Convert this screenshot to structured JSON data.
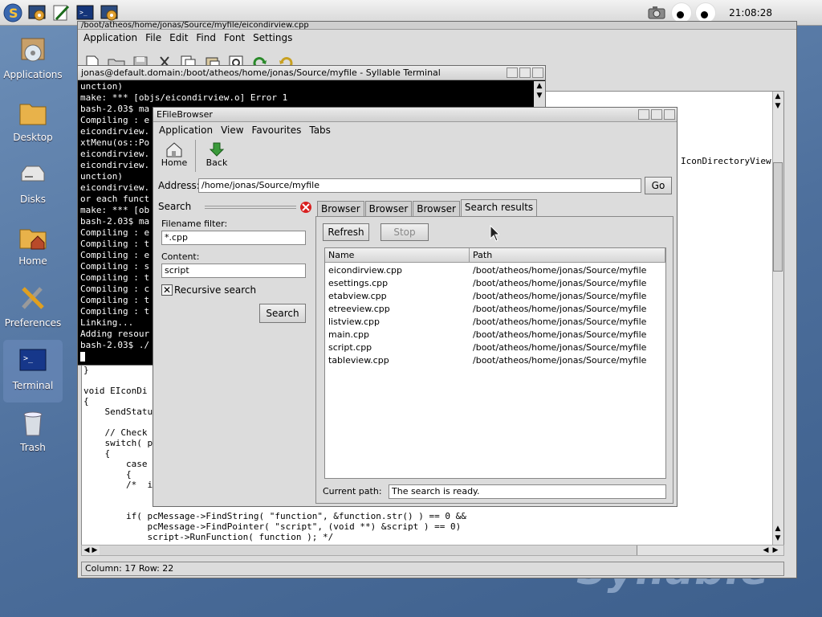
{
  "topbar": {
    "clock": "21:08:28"
  },
  "desktop": {
    "icons": [
      {
        "label": "Applications"
      },
      {
        "label": "Desktop"
      },
      {
        "label": "Disks"
      },
      {
        "label": "Home"
      },
      {
        "label": "Preferences"
      },
      {
        "label": "Terminal"
      },
      {
        "label": "Trash"
      }
    ],
    "logo": "Syllable"
  },
  "editor": {
    "title_fragment": "/boot/atheos/home/jonas/Source/myfile/eicondirview.cpp",
    "menu": [
      "Application",
      "File",
      "Edit",
      "Find",
      "Font",
      "Settings"
    ],
    "right_text": "IconDirectoryView(",
    "code_lines": [
      "}",
      "",
      "void EIconDi",
      "{",
      "    SendStatu",
      "",
      "    // Check",
      "    switch( p",
      "    {",
      "        case",
      "        {",
      "        /*  i"
    ],
    "code_lines_lower": [
      "        if( pcMessage->FindString( \"function\", &function.str() ) == 0 &&",
      "            pcMessage->FindPointer( \"script\", (void **) &script ) == 0)",
      "            script->RunFunction( function ); */"
    ],
    "status": "Column: 17 Row: 22"
  },
  "terminal": {
    "title": "jonas@default.domain:/boot/atheos/home/jonas/Source/myfile - Syllable Terminal",
    "lines": [
      "unction)",
      "make: *** [objs/eicondirview.o] Error 1",
      "bash-2.03$ ma",
      "Compiling : e",
      "eicondirview.",
      "xtMenu(os::Po",
      "eicondirview.",
      "eicondirview.",
      "unction)",
      "eicondirview.",
      "or each funct",
      "make: *** [ob",
      "bash-2.03$ ma",
      "Compiling : e",
      "Compiling : t",
      "Compiling : e",
      "Compiling : s",
      "Compiling : t",
      "Compiling : c",
      "Compiling : t",
      "Compiling : t",
      "Linking...",
      "Adding resour",
      "bash-2.03$ ./"
    ]
  },
  "filebrowser": {
    "title": "EFileBrowser",
    "menu": [
      "Application",
      "View",
      "Favourites",
      "Tabs"
    ],
    "tools": {
      "home": "Home",
      "back": "Back"
    },
    "address_label": "Address:",
    "address_value": "/home/jonas/Source/myfile",
    "go_label": "Go",
    "search": {
      "title": "Search",
      "filename_label": "Filename filter:",
      "filename_value": "*.cpp",
      "content_label": "Content:",
      "content_value": "script",
      "recursive_label": "Recursive search",
      "recursive_checked": true,
      "search_button": "Search"
    },
    "tabs": [
      "Browser",
      "Browser",
      "Browser",
      "Search results"
    ],
    "results": {
      "refresh_label": "Refresh",
      "stop_label": "Stop",
      "columns": [
        "Name",
        "Path"
      ],
      "rows": [
        {
          "name": "eicondirview.cpp",
          "path": "/boot/atheos/home/jonas/Source/myfile"
        },
        {
          "name": "esettings.cpp",
          "path": "/boot/atheos/home/jonas/Source/myfile"
        },
        {
          "name": "etabview.cpp",
          "path": "/boot/atheos/home/jonas/Source/myfile"
        },
        {
          "name": "etreeview.cpp",
          "path": "/boot/atheos/home/jonas/Source/myfile"
        },
        {
          "name": "listview.cpp",
          "path": "/boot/atheos/home/jonas/Source/myfile"
        },
        {
          "name": "main.cpp",
          "path": "/boot/atheos/home/jonas/Source/myfile"
        },
        {
          "name": "script.cpp",
          "path": "/boot/atheos/home/jonas/Source/myfile"
        },
        {
          "name": "tableview.cpp",
          "path": "/boot/atheos/home/jonas/Source/myfile"
        }
      ],
      "current_path_label": "Current path:",
      "current_path_value": "The search is ready."
    }
  }
}
